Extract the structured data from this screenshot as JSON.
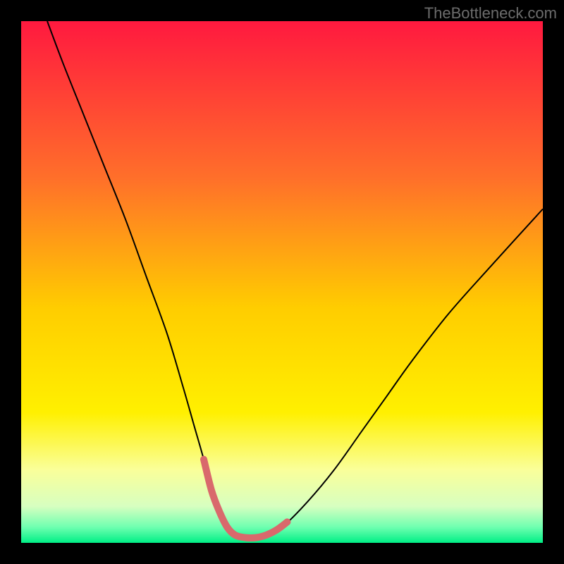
{
  "watermark": "TheBottleneck.com",
  "chart_data": {
    "type": "line",
    "title": "",
    "xlabel": "",
    "ylabel": "",
    "xlim": [
      0,
      100
    ],
    "ylim": [
      0,
      100
    ],
    "background_gradient": {
      "top_color": "#ff193f",
      "mid_upper_color": "#ff8a1e",
      "mid_color": "#ffe400",
      "mid_lower_color": "#f8ff80",
      "bottom_color": "#00ef85"
    },
    "series": [
      {
        "name": "bottleneck-curve",
        "color": "#000000",
        "stroke_width": 2,
        "x": [
          5,
          8,
          12,
          16,
          20,
          24,
          28,
          31,
          33,
          35,
          36.5,
          38,
          39.5,
          41,
          43,
          45,
          47,
          50,
          55,
          60,
          65,
          70,
          75,
          82,
          90,
          100
        ],
        "y": [
          100,
          92,
          82,
          72,
          62,
          51,
          40,
          30,
          23,
          16,
          10,
          6,
          3,
          1.5,
          1,
          1,
          1.5,
          3,
          8,
          14,
          21,
          28,
          35,
          44,
          53,
          64
        ]
      },
      {
        "name": "optimal-zone-marker",
        "color": "#d9696c",
        "stroke_width": 10,
        "linecap": "round",
        "x": [
          35,
          36.5,
          38,
          39.5,
          41,
          43,
          45,
          47,
          49,
          51
        ],
        "y": [
          16,
          10,
          6,
          3,
          1.5,
          1,
          1,
          1.5,
          2.5,
          4
        ]
      }
    ]
  }
}
